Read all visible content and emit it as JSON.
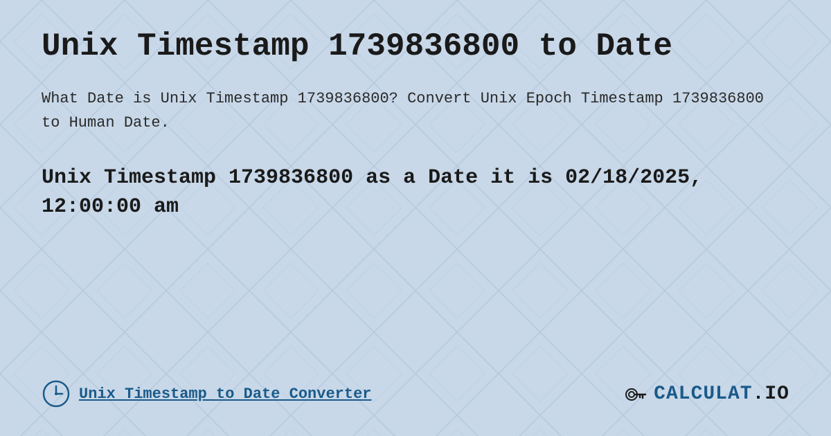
{
  "background": {
    "color": "#c8d8e8"
  },
  "header": {
    "title": "Unix Timestamp 1739836800 to Date"
  },
  "description": {
    "text": "What Date is Unix Timestamp 1739836800? Convert Unix Epoch Timestamp 1739836800 to Human Date."
  },
  "result": {
    "text": "Unix Timestamp 1739836800 as a Date it is 02/18/2025, 12:00:00 am"
  },
  "footer": {
    "link_label": "Unix Timestamp to Date Converter",
    "logo_text": "CALCULAT.IO"
  }
}
